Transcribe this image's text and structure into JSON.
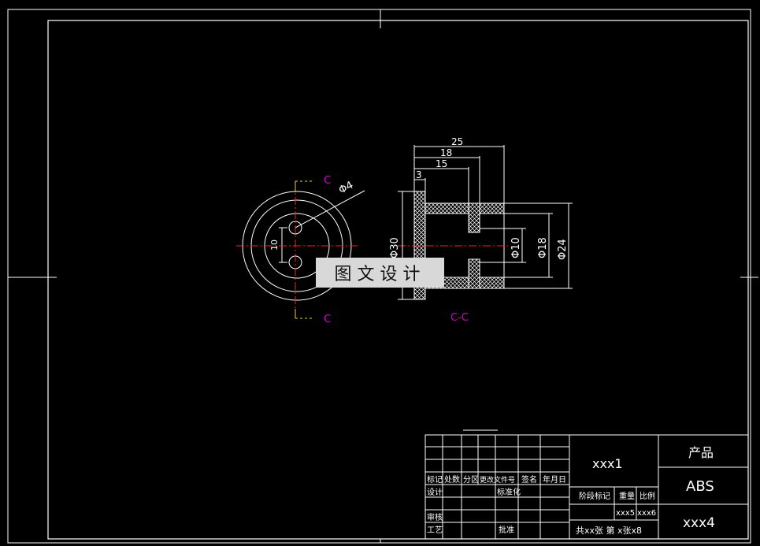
{
  "section_marks": {
    "top": "C",
    "bottom": "C",
    "view_label": "C-C"
  },
  "dimensions": {
    "diameter_small": "Φ4",
    "center_distance": "10",
    "len_25": "25",
    "len_18": "18",
    "len_15": "15",
    "len_3": "3",
    "dia_30": "Φ30",
    "dia_10": "Φ10",
    "dia_18": "Φ18",
    "dia_24": "Φ24"
  },
  "watermark": "图文设计",
  "title_block": {
    "headers": [
      "标记",
      "处数",
      "分区",
      "更改文件号",
      "签名",
      "年月日"
    ],
    "row_design": "设计",
    "row_standard": "标准化",
    "row_review": "审核",
    "row_process": "工艺",
    "row_approve": "批准",
    "stage_mark": "阶段标记",
    "weight": "重量",
    "scale": "比例",
    "drawing_name": "xxx1",
    "weight_value": "xxx5",
    "scale_value": "xxx6",
    "sheets_text": "共xx张 第 x张x8",
    "product_label": "产品",
    "material": "ABS",
    "drawing_number": "xxx4"
  },
  "colors": {
    "line": "#ffffff",
    "center": "#ff2020",
    "section": "#d100d1",
    "hatch": "#ffffff"
  }
}
